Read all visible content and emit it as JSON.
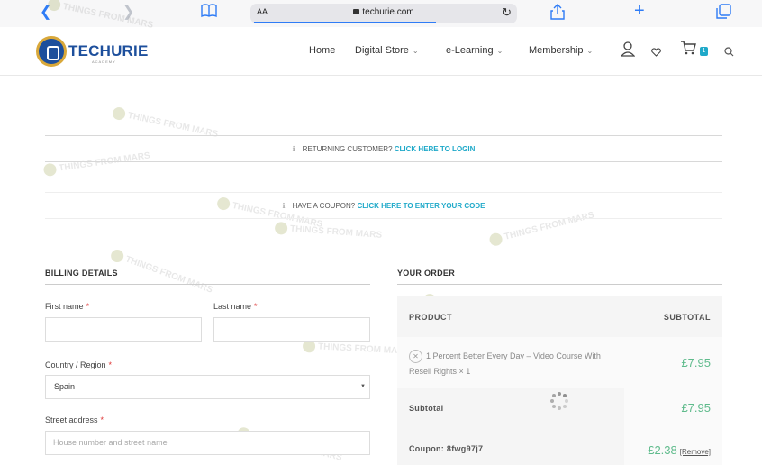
{
  "browser": {
    "text_size_label": "AA",
    "url": "techurie.com"
  },
  "site": {
    "logo_text": "TECHURIE",
    "logo_sub": "ACADEMY",
    "nav": [
      {
        "label": "Home",
        "has_dropdown": false
      },
      {
        "label": "Digital Store",
        "has_dropdown": true
      },
      {
        "label": "e-Learning",
        "has_dropdown": true
      },
      {
        "label": "Membership",
        "has_dropdown": true
      }
    ],
    "cart_count": "1"
  },
  "watermark_text": "THINGS FROM MARS",
  "notices": {
    "login_text": "RETURNING CUSTOMER?",
    "login_link": "CLICK HERE TO LOGIN",
    "coupon_text": "HAVE A COUPON?",
    "coupon_link": "CLICK HERE TO ENTER YOUR CODE"
  },
  "billing": {
    "title": "BILLING DETAILS",
    "first_name_label": "First name",
    "last_name_label": "Last name",
    "country_label": "Country / Region",
    "country_value": "Spain",
    "street_label": "Street address",
    "street_placeholder": "House number and street name",
    "required_marker": "*"
  },
  "order": {
    "title": "YOUR ORDER",
    "col_product": "PRODUCT",
    "col_subtotal": "SUBTOTAL",
    "item_name": "1 Percent Better Every Day – Video Course With Resell Rights",
    "item_qty": "× 1",
    "item_price": "£7.95",
    "subtotal_label": "Subtotal",
    "subtotal_value": "£7.95",
    "coupon_label": "Coupon: 8fwg97j7",
    "coupon_value": "-£2.38",
    "coupon_remove": "[Remove]"
  },
  "colors": {
    "accent": "#1fa9c9",
    "price": "#5fbb8c",
    "browser_blue": "#2f7cf6",
    "brand": "#1d4f9c"
  }
}
